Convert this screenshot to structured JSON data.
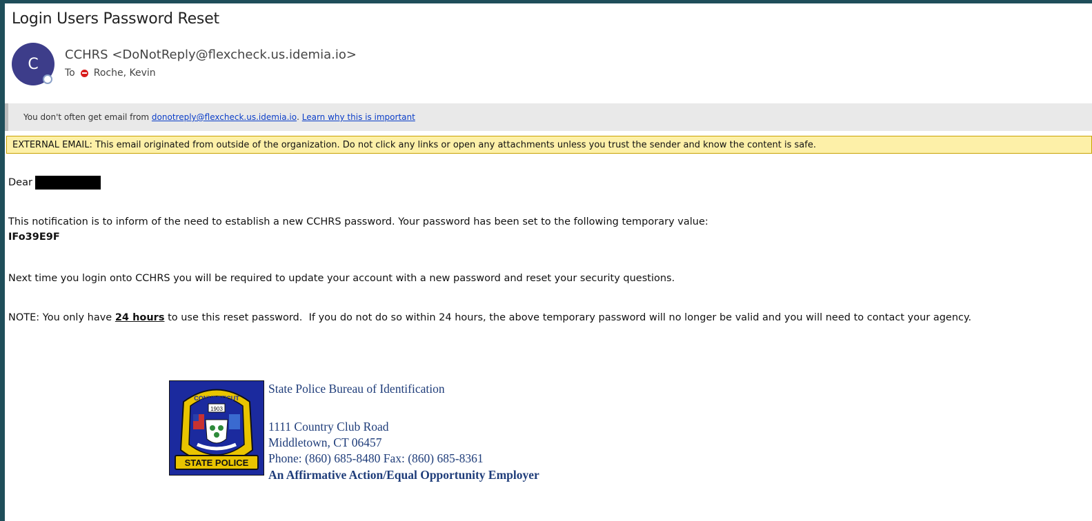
{
  "email": {
    "subject": "Login Users Password Reset",
    "avatar_initial": "C",
    "from": "CCHRS <DoNotReply@flexcheck.us.idemia.io>",
    "to_label": "To",
    "to_name": "Roche, Kevin"
  },
  "notice": {
    "prefix": "You don't often get email from ",
    "sender_link": "donotreply@flexcheck.us.idemia.io",
    "separator": ". ",
    "learn_link": "Learn why this is important"
  },
  "external_warning": "EXTERNAL EMAIL: This email originated from outside of the organization. Do not click any links or open any attachments unless you trust the sender and know the content is safe.",
  "body": {
    "greeting": "Dear",
    "para1": "This notification is to inform of the need to establish a new CCHRS password.  Your password has been set to the following temporary value:",
    "temp_password": "IFo39E9F",
    "para2": "Next time you login onto CCHRS you will be required to update your account with a new password and reset your security questions.",
    "note_prefix": "NOTE: You only have ",
    "note_hours": "24 hours",
    "note_suffix": " to use this reset password.  If you do not do so within 24 hours, the above temporary password will no longer be valid and you will need to contact your agency."
  },
  "signature": {
    "org": "State Police Bureau of Identification",
    "address1": "1111 Country Club Road",
    "address2": "Middletown, CT 06457",
    "phone": "Phone: (860) 685-8480 Fax: (860) 685-8361",
    "eoe": "An Affirmative Action/Equal Opportunity Employer",
    "logo_top": "CONNECTICUT",
    "logo_year": "1903",
    "logo_bottom": "STATE POLICE"
  },
  "colors": {
    "avatar": "#3d3d8a",
    "external_bg": "#fdf0a8",
    "link": "#0b3ec8",
    "signature": "#1f3d7a"
  }
}
